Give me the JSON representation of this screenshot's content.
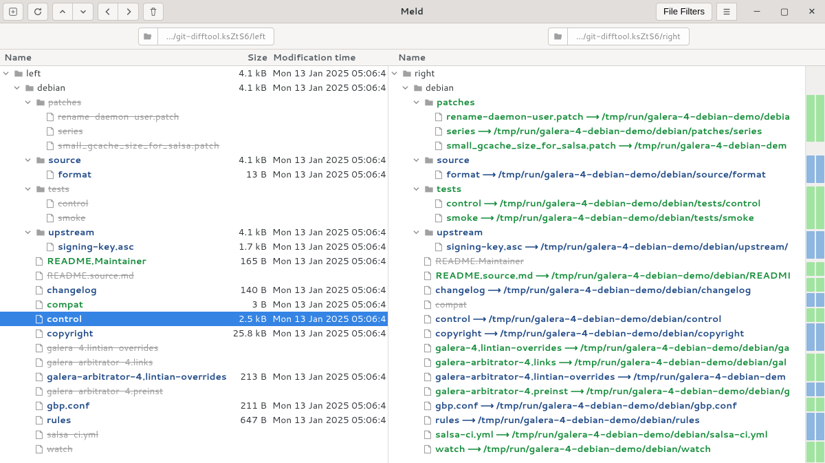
{
  "app": {
    "title": "Meld",
    "file_filters": "File Filters"
  },
  "paths": {
    "left": ".../git-difftool.ksZtS6/left",
    "right": ".../git-difftool.ksZtS6/right"
  },
  "headers": {
    "name": "Name",
    "size": "Size",
    "mod": "Modification time"
  },
  "left": {
    "root": "left",
    "root_size": "4.1 kB",
    "root_mod": "Mon 13 Jan 2025 05:06:4",
    "debian": "debian",
    "debian_size": "4.1 kB",
    "debian_mod": "Mon 13 Jan 2025 05:06:4",
    "patches": "patches",
    "patch_rename": "rename-daemon-user.patch",
    "patch_series": "series",
    "patch_small": "small_gcache_size_for_salsa.patch",
    "source": "source",
    "source_size": "4.1 kB",
    "source_mod": "Mon 13 Jan 2025 05:06:4",
    "format": "format",
    "format_size": "13 B",
    "format_mod": "Mon 13 Jan 2025 05:06:4",
    "tests": "tests",
    "tests_control": "control",
    "tests_smoke": "smoke",
    "upstream": "upstream",
    "upstream_size": "4.1 kB",
    "upstream_mod": "Mon 13 Jan 2025 05:06:4",
    "signing": "signing-key.asc",
    "signing_size": "1.7 kB",
    "signing_mod": "Mon 13 Jan 2025 05:06:4",
    "readme_maint": "README.Maintainer",
    "readme_maint_size": "165 B",
    "readme_maint_mod": "Mon 13 Jan 2025 05:06:4",
    "readme_source": "README.source.md",
    "changelog": "changelog",
    "changelog_size": "140 B",
    "changelog_mod": "Mon 13 Jan 2025 05:06:4",
    "compat": "compat",
    "compat_size": "3 B",
    "compat_mod": "Mon 13 Jan 2025 05:06:4",
    "control": "control",
    "control_size": "2.5 kB",
    "control_mod": "Mon 13 Jan 2025 05:06:4",
    "copyright": "copyright",
    "copyright_size": "25.8 kB",
    "copyright_mod": "Mon 13 Jan 2025 05:06:4",
    "lintian": "galera-4.lintian-overrides",
    "arb_links": "galera-arbitrator-4.links",
    "arb_lintian": "galera-arbitrator-4.lintian-overrides",
    "arb_lintian_size": "213 B",
    "arb_lintian_mod": "Mon 13 Jan 2025 05:06:4",
    "arb_preinst": "galera-arbitrator-4.preinst",
    "gbp": "gbp.conf",
    "gbp_size": "211 B",
    "gbp_mod": "Mon 13 Jan 2025 05:06:4",
    "rules": "rules",
    "rules_size": "647 B",
    "rules_mod": "Mon 13 Jan 2025 05:06:4",
    "salsa": "salsa-ci.yml",
    "watch": "watch"
  },
  "right": {
    "root": "right",
    "debian": "debian",
    "patches": "patches",
    "patch_rename": "rename-daemon-user.patch ⟶ /tmp/run/galera-4-debian-demo/debia",
    "patch_series": "series ⟶ /tmp/run/galera-4-debian-demo/debian/patches/series",
    "patch_small": "small_gcache_size_for_salsa.patch ⟶ /tmp/run/galera-4-debian-dem",
    "source": "source",
    "format": "format ⟶ /tmp/run/galera-4-debian-demo/debian/source/format",
    "tests": "tests",
    "tests_control": "control ⟶ /tmp/run/galera-4-debian-demo/debian/tests/control",
    "tests_smoke": "smoke ⟶ /tmp/run/galera-4-debian-demo/debian/tests/smoke",
    "upstream": "upstream",
    "signing": "signing-key.asc ⟶ /tmp/run/galera-4-debian-demo/debian/upstream/",
    "readme_maint": "README.Maintainer",
    "readme_source": "README.source.md ⟶ /tmp/run/galera-4-debian-demo/debian/READMI",
    "changelog": "changelog ⟶ /tmp/run/galera-4-debian-demo/debian/changelog",
    "compat": "compat",
    "control": "control ⟶ /tmp/run/galera-4-debian-demo/debian/control",
    "copyright": "copyright ⟶ /tmp/run/galera-4-debian-demo/debian/copyright",
    "lintian": "galera-4.lintian-overrides ⟶ /tmp/run/galera-4-debian-demo/debian/ga",
    "arb_links": "galera-arbitrator-4.links ⟶ /tmp/run/galera-4-debian-demo/debian/gal",
    "arb_lintian": "galera-arbitrator-4.lintian-overrides ⟶ /tmp/run/galera-4-debian-dem",
    "arb_preinst": "galera-arbitrator-4.preinst ⟶ /tmp/run/galera-4-debian-demo/debian/g",
    "gbp": "gbp.conf ⟶ /tmp/run/galera-4-debian-demo/debian/gbp.conf",
    "rules": "rules ⟶ /tmp/run/galera-4-debian-demo/debian/rules",
    "salsa": "salsa-ci.yml ⟶ /tmp/run/galera-4-debian-demo/debian/salsa-ci.yml",
    "watch": "watch ⟶ /tmp/run/galera-4-debian-demo/debian/watch"
  }
}
